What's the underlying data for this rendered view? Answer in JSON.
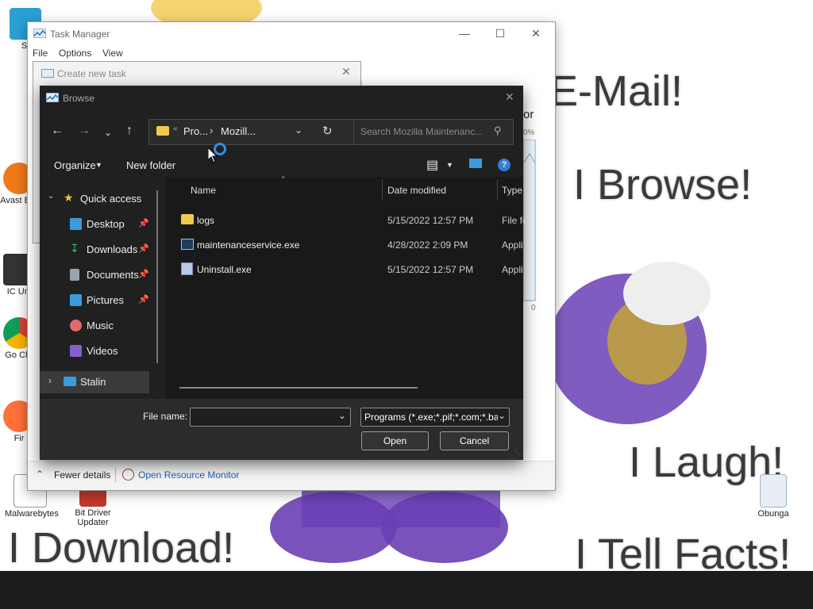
{
  "wallpaper": {
    "lines": [
      "E-Mail!",
      "I Browse!",
      "I Laugh!",
      "I Download!",
      "I Tell Facts!"
    ]
  },
  "desktop_icons": [
    {
      "label": "St",
      "icon": "monitor-icon"
    },
    {
      "label": "Avast Bro",
      "icon": "avast-icon"
    },
    {
      "label": "IC Uni",
      "icon": "app-icon"
    },
    {
      "label": "Go Chr",
      "icon": "chrome-icon"
    },
    {
      "label": "Fir",
      "icon": "firefox-icon"
    },
    {
      "label": "Malwarebytes",
      "icon": "malwarebytes-icon"
    },
    {
      "label": "Bit Driver Updater",
      "icon": "bit-driver-icon"
    },
    {
      "label": "Obunga",
      "icon": "recycle-bin-icon"
    }
  ],
  "task_manager": {
    "title": "Task Manager",
    "menu": [
      "File",
      "Options",
      "View"
    ],
    "partial_text": "or",
    "percent": "0%",
    "zero": "0",
    "fewer_details": "Fewer details",
    "resource_monitor": "Open Resource Monitor"
  },
  "create_task": {
    "title": "Create new task"
  },
  "browse": {
    "title": "Browse",
    "breadcrumb": [
      "Pro...",
      "Mozill..."
    ],
    "search_placeholder": "Search Mozilla Maintenanc...",
    "organize": "Organize",
    "new_folder": "New folder",
    "help": "?",
    "sidebar": [
      {
        "label": "Quick access",
        "icon": "star-icon",
        "color": "#f2c230"
      },
      {
        "label": "Desktop",
        "icon": "desktop-folder-icon",
        "color": "#3c9be0",
        "pinned": true
      },
      {
        "label": "Downloads",
        "icon": "download-icon",
        "color": "#3bb36a",
        "pinned": true
      },
      {
        "label": "Documents",
        "icon": "documents-icon",
        "color": "#9aa3ad",
        "pinned": true
      },
      {
        "label": "Pictures",
        "icon": "pictures-icon",
        "color": "#3c9be0",
        "pinned": true
      },
      {
        "label": "Music",
        "icon": "music-icon",
        "color": "#e06b6b"
      },
      {
        "label": "Videos",
        "icon": "videos-icon",
        "color": "#8a5cd1"
      },
      {
        "label": "Stalin",
        "icon": "computer-icon",
        "color": "#3c9be0"
      }
    ],
    "columns": [
      "Name",
      "Date modified",
      "Type"
    ],
    "files": [
      {
        "name": "logs",
        "date": "5/15/2022 12:57 PM",
        "type": "File fo",
        "icon": "folder-icon"
      },
      {
        "name": "maintenanceservice.exe",
        "date": "4/28/2022 2:09 PM",
        "type": "Appli",
        "icon": "exe-icon"
      },
      {
        "name": "Uninstall.exe",
        "date": "5/15/2022 12:57 PM",
        "type": "Appli",
        "icon": "installer-icon"
      }
    ],
    "file_name_label": "File name:",
    "file_name_value": "",
    "file_type": "Programs (*.exe;*.pif;*.com;*.ba",
    "open": "Open",
    "cancel": "Cancel"
  }
}
